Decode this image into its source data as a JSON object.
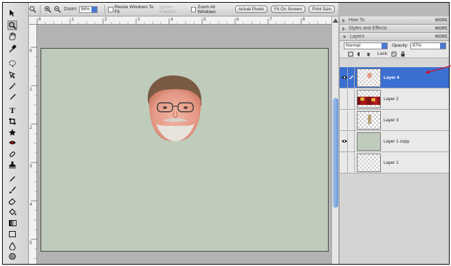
{
  "options_bar": {
    "zoom_label": "Zoom:",
    "zoom_value": "56%",
    "resize_windows_label": "Resize Windows To Fit",
    "ignore_palettes_label": "Ignore Palettes",
    "zoom_all_windows_label": "Zoom All Windows",
    "actual_pixels_label": "Actual Pixels",
    "fit_on_screen_label": "Fit On Screen",
    "print_size_label": "Print Size"
  },
  "ruler": {
    "top_ticks": [
      "0",
      "1",
      "2",
      "3",
      "4",
      "5",
      "6",
      "7",
      "8"
    ],
    "left_ticks": [
      "0",
      "1",
      "2",
      "3",
      "4",
      "5"
    ]
  },
  "panels": {
    "how_to": {
      "label": "How To",
      "more": "MORE"
    },
    "styles": {
      "label": "Styles and Effects",
      "more": "MORE"
    },
    "layers_tab": {
      "label": "Layers",
      "more": "MORE"
    },
    "blend_mode": "Normal",
    "opacity_label": "Opacity:",
    "opacity_value": "97%",
    "lock_label": "Lock:"
  },
  "layers": [
    {
      "name": "Layer 4",
      "visible": true,
      "selected": true
    },
    {
      "name": "Layer 2",
      "visible": false,
      "selected": false
    },
    {
      "name": "Layer 3",
      "visible": false,
      "selected": false
    },
    {
      "name": "Layer 1 copy",
      "visible": true,
      "selected": false
    },
    {
      "name": "Layer 1",
      "visible": false,
      "selected": false
    }
  ],
  "colors": {
    "canvas": "#c0ccbb",
    "selection": "#3b6fd1",
    "annotation_arrow": "#d0102a"
  }
}
